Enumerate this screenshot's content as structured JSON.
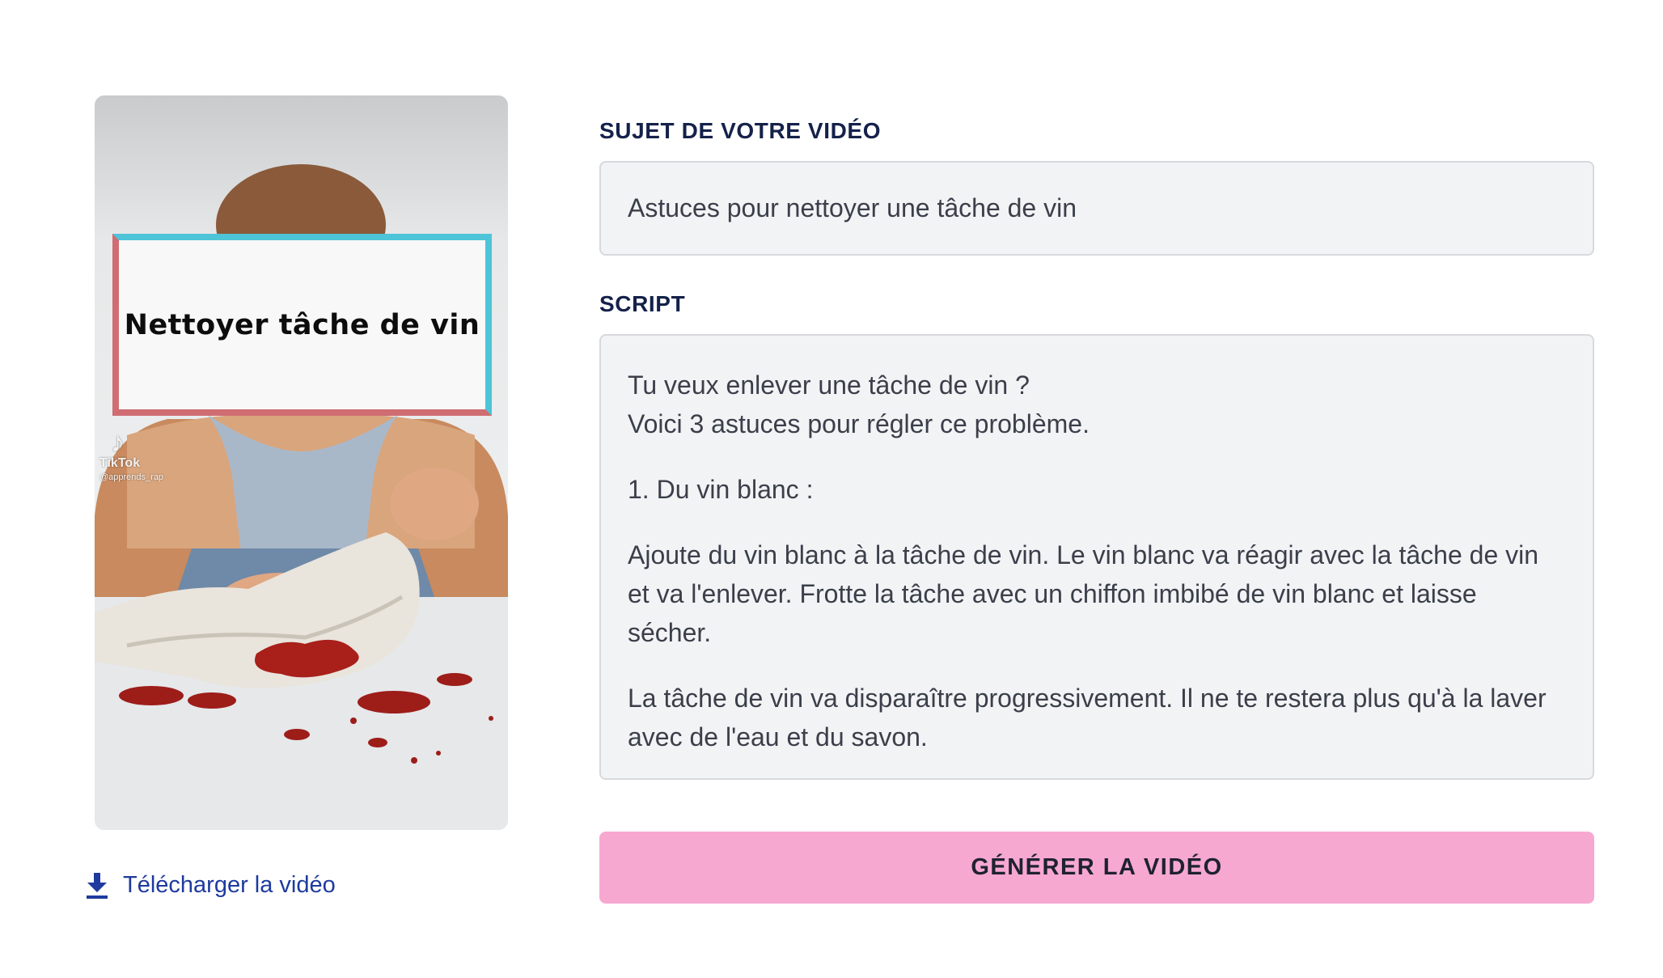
{
  "video": {
    "overlay_title": "Nettoyer tâche de vin",
    "watermark_brand": "TikTok",
    "watermark_handle": "@apprends_rap"
  },
  "download": {
    "label": "Télécharger la vidéo",
    "icon": "download-icon"
  },
  "form": {
    "subject_label": "SUJET DE VOTRE VIDÉO",
    "subject_value": "Astuces pour nettoyer une tâche de vin",
    "script_label": "SCRIPT",
    "script_paragraphs": [
      "Tu veux enlever une tâche de vin ?",
      "Voici 3 astuces pour régler ce problème.",
      "1. Du vin blanc :",
      "Ajoute du vin blanc à la tâche de vin. Le vin blanc va réagir avec la tâche de vin et va l'enlever. Frotte la tâche avec un chiffon imbibé de vin blanc et laisse sécher.",
      "La tâche de vin va disparaître progressivement. Il ne te restera plus qu'à la laver avec de l'eau et du savon."
    ],
    "generate_label": "GÉNÉRER LA VIDÉO"
  },
  "colors": {
    "accent_pink": "#f7a8d1",
    "label_navy": "#14214a",
    "link_blue": "#1e3a9e",
    "field_bg": "#f2f3f5"
  }
}
